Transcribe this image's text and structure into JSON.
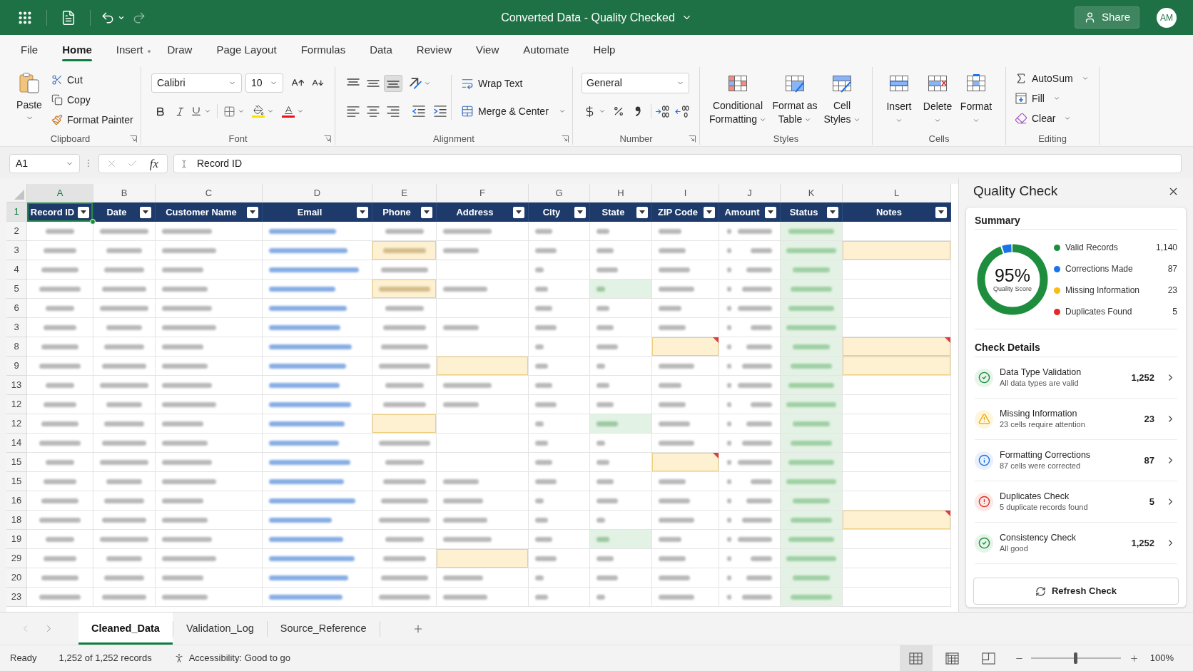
{
  "title_bar": {
    "title": "Converted Data - Quality Checked",
    "share": "Share",
    "avatar": "AM"
  },
  "menu_tabs": [
    {
      "label": "File",
      "selected": false,
      "dot": false
    },
    {
      "label": "Home",
      "selected": true,
      "dot": false
    },
    {
      "label": "Insert",
      "selected": false,
      "dot": true
    },
    {
      "label": "Draw",
      "selected": false,
      "dot": false
    },
    {
      "label": "Page Layout",
      "selected": false,
      "dot": false
    },
    {
      "label": "Formulas",
      "selected": false,
      "dot": false
    },
    {
      "label": "Data",
      "selected": false,
      "dot": false
    },
    {
      "label": "Review",
      "selected": false,
      "dot": false
    },
    {
      "label": "View",
      "selected": false,
      "dot": false
    },
    {
      "label": "Automate",
      "selected": false,
      "dot": false
    },
    {
      "label": "Help",
      "selected": false,
      "dot": false
    }
  ],
  "ribbon": {
    "clipboard": {
      "label": "Clipboard",
      "paste": "Paste",
      "cut": "Cut",
      "copy": "Copy",
      "format_painter": "Format Painter"
    },
    "font": {
      "label": "Font",
      "family": "Calibri",
      "size": "10"
    },
    "alignment": {
      "label": "Alignment",
      "vertical": [
        {
          "kind": "top",
          "selected": false
        },
        {
          "kind": "middle",
          "selected": false
        },
        {
          "kind": "bottom",
          "selected": true
        }
      ],
      "horizontal": [
        {
          "kind": "left",
          "selected": false
        },
        {
          "kind": "center",
          "selected": false
        },
        {
          "kind": "right",
          "selected": false
        }
      ],
      "wrap_text": "Wrap Text",
      "merge": "Merge & Center"
    },
    "number": {
      "label": "Number",
      "format": "General"
    },
    "styles": {
      "label": "Styles",
      "buttons": [
        {
          "kind": "conditional",
          "label": "Conditional Formatting"
        },
        {
          "kind": "table",
          "label": "Format as Table"
        },
        {
          "kind": "cell-styles",
          "label": "Cell Styles"
        }
      ]
    },
    "cells": {
      "label": "Cells",
      "buttons": [
        {
          "kind": "insert",
          "label": "Insert"
        },
        {
          "kind": "delete",
          "label": "Delete"
        },
        {
          "kind": "format",
          "label": "Format"
        }
      ]
    },
    "editing": {
      "label": "Editing",
      "buttons": [
        {
          "kind": "autosum",
          "label": "AutoSum"
        },
        {
          "kind": "fill",
          "label": "Fill"
        },
        {
          "kind": "clear",
          "label": "Clear"
        }
      ]
    }
  },
  "formula_bar": {
    "name_box": "A1",
    "function_label": "fx",
    "content": "Record ID"
  },
  "table": {
    "columns": [
      {
        "letter": "A",
        "header": "Record ID",
        "kind": "text",
        "selected": true
      },
      {
        "letter": "B",
        "header": "Date",
        "kind": "text",
        "selected": false
      },
      {
        "letter": "C",
        "header": "Customer Name",
        "kind": "text",
        "selected": false
      },
      {
        "letter": "D",
        "header": "Email",
        "kind": "link",
        "selected": false
      },
      {
        "letter": "E",
        "header": "Phone",
        "kind": "text",
        "selected": false
      },
      {
        "letter": "F",
        "header": "Address",
        "kind": "text",
        "selected": false
      },
      {
        "letter": "G",
        "header": "City",
        "kind": "text",
        "selected": false
      },
      {
        "letter": "H",
        "header": "State",
        "kind": "text",
        "selected": false
      },
      {
        "letter": "I",
        "header": "ZIP Code",
        "kind": "text",
        "selected": false
      },
      {
        "letter": "J",
        "header": "Amount",
        "kind": "amount",
        "selected": false
      },
      {
        "letter": "K",
        "header": "Status",
        "kind": "status",
        "selected": false
      },
      {
        "letter": "L",
        "header": "Notes",
        "kind": "text",
        "selected": false
      }
    ],
    "header_row": {
      "number": "1",
      "selected": true
    },
    "rows": [
      {
        "number": "2",
        "cells": [
          {
            "filled": true,
            "kind": "plain",
            "note": false
          },
          {
            "filled": true,
            "kind": "plain",
            "note": false
          },
          {
            "filled": true,
            "kind": "plain",
            "note": false
          },
          {
            "filled": true,
            "kind": "plain",
            "note": false
          },
          {
            "filled": true,
            "kind": "plain",
            "note": false
          },
          {
            "filled": true,
            "kind": "plain",
            "note": false
          },
          {
            "filled": true,
            "kind": "plain",
            "note": false
          },
          {
            "filled": true,
            "kind": "plain",
            "note": false
          },
          {
            "filled": true,
            "kind": "plain",
            "note": false
          },
          {
            "filled": true,
            "kind": "plain",
            "note": false
          },
          {
            "filled": true,
            "kind": "plain",
            "note": false
          },
          {
            "filled": false,
            "kind": "plain",
            "note": false
          }
        ]
      },
      {
        "number": "3",
        "cells": [
          {
            "filled": true,
            "kind": "plain",
            "note": false
          },
          {
            "filled": true,
            "kind": "plain",
            "note": false
          },
          {
            "filled": true,
            "kind": "plain",
            "note": false
          },
          {
            "filled": true,
            "kind": "plain",
            "note": false
          },
          {
            "filled": true,
            "kind": "missing",
            "note": false
          },
          {
            "filled": true,
            "kind": "plain",
            "note": false
          },
          {
            "filled": true,
            "kind": "plain",
            "note": false
          },
          {
            "filled": true,
            "kind": "plain",
            "note": false
          },
          {
            "filled": true,
            "kind": "plain",
            "note": false
          },
          {
            "filled": true,
            "kind": "plain",
            "note": false
          },
          {
            "filled": true,
            "kind": "plain",
            "note": false
          },
          {
            "filled": false,
            "kind": "missing",
            "note": false
          }
        ]
      },
      {
        "number": "4",
        "cells": [
          {
            "filled": true,
            "kind": "plain",
            "note": false
          },
          {
            "filled": true,
            "kind": "plain",
            "note": false
          },
          {
            "filled": true,
            "kind": "plain",
            "note": false
          },
          {
            "filled": true,
            "kind": "plain",
            "note": false
          },
          {
            "filled": true,
            "kind": "plain",
            "note": false
          },
          {
            "filled": false,
            "kind": "plain",
            "note": false
          },
          {
            "filled": true,
            "kind": "plain",
            "note": false
          },
          {
            "filled": true,
            "kind": "plain",
            "note": false
          },
          {
            "filled": true,
            "kind": "plain",
            "note": false
          },
          {
            "filled": true,
            "kind": "plain",
            "note": false
          },
          {
            "filled": true,
            "kind": "plain",
            "note": false
          },
          {
            "filled": false,
            "kind": "plain",
            "note": false
          }
        ]
      },
      {
        "number": "5",
        "cells": [
          {
            "filled": true,
            "kind": "plain",
            "note": false
          },
          {
            "filled": true,
            "kind": "plain",
            "note": false
          },
          {
            "filled": true,
            "kind": "plain",
            "note": false
          },
          {
            "filled": true,
            "kind": "plain",
            "note": false
          },
          {
            "filled": true,
            "kind": "missing",
            "note": false
          },
          {
            "filled": true,
            "kind": "plain",
            "note": false
          },
          {
            "filled": true,
            "kind": "plain",
            "note": false
          },
          {
            "filled": true,
            "kind": "corrected",
            "note": false
          },
          {
            "filled": true,
            "kind": "plain",
            "note": false
          },
          {
            "filled": true,
            "kind": "plain",
            "note": false
          },
          {
            "filled": true,
            "kind": "plain",
            "note": false
          },
          {
            "filled": false,
            "kind": "plain",
            "note": false
          }
        ]
      },
      {
        "number": "6",
        "cells": [
          {
            "filled": true,
            "kind": "plain",
            "note": false
          },
          {
            "filled": true,
            "kind": "plain",
            "note": false
          },
          {
            "filled": true,
            "kind": "plain",
            "note": false
          },
          {
            "filled": true,
            "kind": "plain",
            "note": false
          },
          {
            "filled": true,
            "kind": "plain",
            "note": false
          },
          {
            "filled": false,
            "kind": "plain",
            "note": false
          },
          {
            "filled": true,
            "kind": "plain",
            "note": false
          },
          {
            "filled": true,
            "kind": "plain",
            "note": false
          },
          {
            "filled": true,
            "kind": "plain",
            "note": false
          },
          {
            "filled": true,
            "kind": "plain",
            "note": false
          },
          {
            "filled": true,
            "kind": "plain",
            "note": false
          },
          {
            "filled": false,
            "kind": "plain",
            "note": false
          }
        ]
      },
      {
        "number": "3",
        "cells": [
          {
            "filled": true,
            "kind": "plain",
            "note": false
          },
          {
            "filled": true,
            "kind": "plain",
            "note": false
          },
          {
            "filled": true,
            "kind": "plain",
            "note": false
          },
          {
            "filled": true,
            "kind": "plain",
            "note": false
          },
          {
            "filled": true,
            "kind": "plain",
            "note": false
          },
          {
            "filled": true,
            "kind": "plain",
            "note": false
          },
          {
            "filled": true,
            "kind": "plain",
            "note": false
          },
          {
            "filled": true,
            "kind": "plain",
            "note": false
          },
          {
            "filled": true,
            "kind": "plain",
            "note": false
          },
          {
            "filled": true,
            "kind": "plain",
            "note": false
          },
          {
            "filled": true,
            "kind": "plain",
            "note": false
          },
          {
            "filled": false,
            "kind": "plain",
            "note": false
          }
        ]
      },
      {
        "number": "8",
        "cells": [
          {
            "filled": true,
            "kind": "plain",
            "note": false
          },
          {
            "filled": true,
            "kind": "plain",
            "note": false
          },
          {
            "filled": true,
            "kind": "plain",
            "note": false
          },
          {
            "filled": true,
            "kind": "plain",
            "note": false
          },
          {
            "filled": true,
            "kind": "plain",
            "note": false
          },
          {
            "filled": false,
            "kind": "plain",
            "note": false
          },
          {
            "filled": true,
            "kind": "plain",
            "note": false
          },
          {
            "filled": true,
            "kind": "plain",
            "note": false
          },
          {
            "filled": false,
            "kind": "missing",
            "note": true
          },
          {
            "filled": true,
            "kind": "plain",
            "note": false
          },
          {
            "filled": true,
            "kind": "plain",
            "note": false
          },
          {
            "filled": false,
            "kind": "missing",
            "note": true
          }
        ]
      },
      {
        "number": "9",
        "cells": [
          {
            "filled": true,
            "kind": "plain",
            "note": false
          },
          {
            "filled": true,
            "kind": "plain",
            "note": false
          },
          {
            "filled": true,
            "kind": "plain",
            "note": false
          },
          {
            "filled": true,
            "kind": "plain",
            "note": false
          },
          {
            "filled": true,
            "kind": "plain",
            "note": false
          },
          {
            "filled": false,
            "kind": "missing",
            "note": false
          },
          {
            "filled": true,
            "kind": "plain",
            "note": false
          },
          {
            "filled": true,
            "kind": "plain",
            "note": false
          },
          {
            "filled": true,
            "kind": "plain",
            "note": false
          },
          {
            "filled": true,
            "kind": "plain",
            "note": false
          },
          {
            "filled": true,
            "kind": "plain",
            "note": false
          },
          {
            "filled": false,
            "kind": "missing",
            "note": false
          }
        ]
      },
      {
        "number": "13",
        "cells": [
          {
            "filled": true,
            "kind": "plain",
            "note": false
          },
          {
            "filled": true,
            "kind": "plain",
            "note": false
          },
          {
            "filled": true,
            "kind": "plain",
            "note": false
          },
          {
            "filled": true,
            "kind": "plain",
            "note": false
          },
          {
            "filled": true,
            "kind": "plain",
            "note": false
          },
          {
            "filled": true,
            "kind": "plain",
            "note": false
          },
          {
            "filled": true,
            "kind": "plain",
            "note": false
          },
          {
            "filled": true,
            "kind": "plain",
            "note": false
          },
          {
            "filled": true,
            "kind": "plain",
            "note": false
          },
          {
            "filled": true,
            "kind": "plain",
            "note": false
          },
          {
            "filled": true,
            "kind": "plain",
            "note": false
          },
          {
            "filled": false,
            "kind": "plain",
            "note": false
          }
        ]
      },
      {
        "number": "12",
        "cells": [
          {
            "filled": true,
            "kind": "plain",
            "note": false
          },
          {
            "filled": true,
            "kind": "plain",
            "note": false
          },
          {
            "filled": true,
            "kind": "plain",
            "note": false
          },
          {
            "filled": true,
            "kind": "plain",
            "note": false
          },
          {
            "filled": true,
            "kind": "plain",
            "note": false
          },
          {
            "filled": true,
            "kind": "plain",
            "note": false
          },
          {
            "filled": true,
            "kind": "plain",
            "note": false
          },
          {
            "filled": true,
            "kind": "plain",
            "note": false
          },
          {
            "filled": true,
            "kind": "plain",
            "note": false
          },
          {
            "filled": true,
            "kind": "plain",
            "note": false
          },
          {
            "filled": true,
            "kind": "plain",
            "note": false
          },
          {
            "filled": false,
            "kind": "plain",
            "note": false
          }
        ]
      },
      {
        "number": "12",
        "cells": [
          {
            "filled": true,
            "kind": "plain",
            "note": false
          },
          {
            "filled": true,
            "kind": "plain",
            "note": false
          },
          {
            "filled": true,
            "kind": "plain",
            "note": false
          },
          {
            "filled": true,
            "kind": "plain",
            "note": false
          },
          {
            "filled": false,
            "kind": "missing",
            "note": false
          },
          {
            "filled": false,
            "kind": "plain",
            "note": false
          },
          {
            "filled": true,
            "kind": "plain",
            "note": false
          },
          {
            "filled": true,
            "kind": "corrected",
            "note": false
          },
          {
            "filled": true,
            "kind": "plain",
            "note": false
          },
          {
            "filled": true,
            "kind": "plain",
            "note": false
          },
          {
            "filled": true,
            "kind": "plain",
            "note": false
          },
          {
            "filled": false,
            "kind": "plain",
            "note": false
          }
        ]
      },
      {
        "number": "14",
        "cells": [
          {
            "filled": true,
            "kind": "plain",
            "note": false
          },
          {
            "filled": true,
            "kind": "plain",
            "note": false
          },
          {
            "filled": true,
            "kind": "plain",
            "note": false
          },
          {
            "filled": true,
            "kind": "plain",
            "note": false
          },
          {
            "filled": true,
            "kind": "plain",
            "note": false
          },
          {
            "filled": false,
            "kind": "plain",
            "note": false
          },
          {
            "filled": true,
            "kind": "plain",
            "note": false
          },
          {
            "filled": true,
            "kind": "plain",
            "note": false
          },
          {
            "filled": true,
            "kind": "plain",
            "note": false
          },
          {
            "filled": true,
            "kind": "plain",
            "note": false
          },
          {
            "filled": true,
            "kind": "plain",
            "note": false
          },
          {
            "filled": false,
            "kind": "plain",
            "note": false
          }
        ]
      },
      {
        "number": "15",
        "cells": [
          {
            "filled": true,
            "kind": "plain",
            "note": false
          },
          {
            "filled": true,
            "kind": "plain",
            "note": false
          },
          {
            "filled": true,
            "kind": "plain",
            "note": false
          },
          {
            "filled": true,
            "kind": "plain",
            "note": false
          },
          {
            "filled": true,
            "kind": "plain",
            "note": false
          },
          {
            "filled": false,
            "kind": "plain",
            "note": false
          },
          {
            "filled": true,
            "kind": "plain",
            "note": false
          },
          {
            "filled": true,
            "kind": "plain",
            "note": false
          },
          {
            "filled": false,
            "kind": "missing",
            "note": true
          },
          {
            "filled": true,
            "kind": "plain",
            "note": false
          },
          {
            "filled": true,
            "kind": "plain",
            "note": false
          },
          {
            "filled": false,
            "kind": "plain",
            "note": false
          }
        ]
      },
      {
        "number": "15",
        "cells": [
          {
            "filled": true,
            "kind": "plain",
            "note": false
          },
          {
            "filled": true,
            "kind": "plain",
            "note": false
          },
          {
            "filled": true,
            "kind": "plain",
            "note": false
          },
          {
            "filled": true,
            "kind": "plain",
            "note": false
          },
          {
            "filled": true,
            "kind": "plain",
            "note": false
          },
          {
            "filled": true,
            "kind": "plain",
            "note": false
          },
          {
            "filled": true,
            "kind": "plain",
            "note": false
          },
          {
            "filled": true,
            "kind": "plain",
            "note": false
          },
          {
            "filled": true,
            "kind": "plain",
            "note": false
          },
          {
            "filled": true,
            "kind": "plain",
            "note": false
          },
          {
            "filled": true,
            "kind": "plain",
            "note": false
          },
          {
            "filled": false,
            "kind": "plain",
            "note": false
          }
        ]
      },
      {
        "number": "16",
        "cells": [
          {
            "filled": true,
            "kind": "plain",
            "note": false
          },
          {
            "filled": true,
            "kind": "plain",
            "note": false
          },
          {
            "filled": true,
            "kind": "plain",
            "note": false
          },
          {
            "filled": true,
            "kind": "plain",
            "note": false
          },
          {
            "filled": true,
            "kind": "plain",
            "note": false
          },
          {
            "filled": true,
            "kind": "plain",
            "note": false
          },
          {
            "filled": true,
            "kind": "plain",
            "note": false
          },
          {
            "filled": true,
            "kind": "plain",
            "note": false
          },
          {
            "filled": true,
            "kind": "plain",
            "note": false
          },
          {
            "filled": true,
            "kind": "plain",
            "note": false
          },
          {
            "filled": true,
            "kind": "plain",
            "note": false
          },
          {
            "filled": false,
            "kind": "plain",
            "note": false
          }
        ]
      },
      {
        "number": "18",
        "cells": [
          {
            "filled": true,
            "kind": "plain",
            "note": false
          },
          {
            "filled": true,
            "kind": "plain",
            "note": false
          },
          {
            "filled": true,
            "kind": "plain",
            "note": false
          },
          {
            "filled": true,
            "kind": "plain",
            "note": false
          },
          {
            "filled": true,
            "kind": "plain",
            "note": false
          },
          {
            "filled": true,
            "kind": "plain",
            "note": false
          },
          {
            "filled": true,
            "kind": "plain",
            "note": false
          },
          {
            "filled": true,
            "kind": "plain",
            "note": false
          },
          {
            "filled": true,
            "kind": "plain",
            "note": false
          },
          {
            "filled": true,
            "kind": "plain",
            "note": false
          },
          {
            "filled": true,
            "kind": "plain",
            "note": false
          },
          {
            "filled": false,
            "kind": "missing",
            "note": true
          }
        ]
      },
      {
        "number": "19",
        "cells": [
          {
            "filled": true,
            "kind": "plain",
            "note": false
          },
          {
            "filled": true,
            "kind": "plain",
            "note": false
          },
          {
            "filled": true,
            "kind": "plain",
            "note": false
          },
          {
            "filled": true,
            "kind": "plain",
            "note": false
          },
          {
            "filled": true,
            "kind": "plain",
            "note": false
          },
          {
            "filled": true,
            "kind": "plain",
            "note": false
          },
          {
            "filled": true,
            "kind": "plain",
            "note": false
          },
          {
            "filled": true,
            "kind": "corrected",
            "note": false
          },
          {
            "filled": true,
            "kind": "plain",
            "note": false
          },
          {
            "filled": true,
            "kind": "plain",
            "note": false
          },
          {
            "filled": true,
            "kind": "plain",
            "note": false
          },
          {
            "filled": false,
            "kind": "plain",
            "note": false
          }
        ]
      },
      {
        "number": "29",
        "cells": [
          {
            "filled": true,
            "kind": "plain",
            "note": false
          },
          {
            "filled": true,
            "kind": "plain",
            "note": false
          },
          {
            "filled": true,
            "kind": "plain",
            "note": false
          },
          {
            "filled": true,
            "kind": "plain",
            "note": false
          },
          {
            "filled": true,
            "kind": "plain",
            "note": false
          },
          {
            "filled": false,
            "kind": "missing",
            "note": false
          },
          {
            "filled": true,
            "kind": "plain",
            "note": false
          },
          {
            "filled": true,
            "kind": "plain",
            "note": false
          },
          {
            "filled": true,
            "kind": "plain",
            "note": false
          },
          {
            "filled": true,
            "kind": "plain",
            "note": false
          },
          {
            "filled": true,
            "kind": "plain",
            "note": false
          },
          {
            "filled": false,
            "kind": "plain",
            "note": false
          }
        ]
      },
      {
        "number": "20",
        "cells": [
          {
            "filled": true,
            "kind": "plain",
            "note": false
          },
          {
            "filled": true,
            "kind": "plain",
            "note": false
          },
          {
            "filled": true,
            "kind": "plain",
            "note": false
          },
          {
            "filled": true,
            "kind": "plain",
            "note": false
          },
          {
            "filled": true,
            "kind": "plain",
            "note": false
          },
          {
            "filled": true,
            "kind": "plain",
            "note": false
          },
          {
            "filled": true,
            "kind": "plain",
            "note": false
          },
          {
            "filled": true,
            "kind": "plain",
            "note": false
          },
          {
            "filled": true,
            "kind": "plain",
            "note": false
          },
          {
            "filled": true,
            "kind": "plain",
            "note": false
          },
          {
            "filled": true,
            "kind": "plain",
            "note": false
          },
          {
            "filled": false,
            "kind": "plain",
            "note": false
          }
        ]
      },
      {
        "number": "23",
        "cells": [
          {
            "filled": true,
            "kind": "plain",
            "note": false
          },
          {
            "filled": true,
            "kind": "plain",
            "note": false
          },
          {
            "filled": true,
            "kind": "plain",
            "note": false
          },
          {
            "filled": true,
            "kind": "plain",
            "note": false
          },
          {
            "filled": true,
            "kind": "plain",
            "note": false
          },
          {
            "filled": true,
            "kind": "plain",
            "note": false
          },
          {
            "filled": true,
            "kind": "plain",
            "note": false
          },
          {
            "filled": true,
            "kind": "plain",
            "note": false
          },
          {
            "filled": true,
            "kind": "plain",
            "note": false
          },
          {
            "filled": true,
            "kind": "plain",
            "note": false
          },
          {
            "filled": true,
            "kind": "plain",
            "note": false
          },
          {
            "filled": false,
            "kind": "plain",
            "note": false
          }
        ]
      }
    ]
  },
  "quality_panel": {
    "title": "Quality Check",
    "summary": {
      "heading": "Summary",
      "score": "95%",
      "score_label": "Quality Score",
      "ring": {
        "level": 0.95
      },
      "legend": [
        {
          "label": "Valid Records",
          "value": "1,140",
          "color": "#1e8e3e"
        },
        {
          "label": "Corrections Made",
          "value": "87",
          "color": "#1a73e8"
        },
        {
          "label": "Missing Information",
          "value": "23",
          "color": "#f9bc15"
        },
        {
          "label": "Duplicates Found",
          "value": "5",
          "color": "#e02b2b"
        }
      ]
    },
    "details": {
      "heading": "Check Details",
      "items": [
        {
          "kind": "success",
          "title": "Data Type Validation",
          "description": "All data types are valid",
          "count": "1,252"
        },
        {
          "kind": "warning",
          "title": "Missing Information",
          "description": "23 cells require attention",
          "count": "23"
        },
        {
          "kind": "info",
          "title": "Formatting Corrections",
          "description": "87 cells were corrected",
          "count": "87"
        },
        {
          "kind": "error",
          "title": "Duplicates Check",
          "description": "5 duplicate records found",
          "count": "5"
        },
        {
          "kind": "success",
          "title": "Consistency Check",
          "description": "All good",
          "count": "1,252"
        }
      ]
    },
    "refresh": "Refresh Check"
  },
  "sheet_tabs": [
    {
      "label": "Cleaned_Data",
      "selected": true
    },
    {
      "label": "Validation_Log",
      "selected": false
    },
    {
      "label": "Source_Reference",
      "selected": false
    }
  ],
  "status_bar": {
    "state": "Ready",
    "records": "1,252 of 1,252 records",
    "accessibility": "Accessibility: Good to go",
    "views": [
      {
        "kind": "normal",
        "selected": true
      },
      {
        "kind": "page-layout",
        "selected": false
      },
      {
        "kind": "page-break",
        "selected": false
      }
    ],
    "zoom": {
      "level": 0.5,
      "label": "100%"
    }
  }
}
